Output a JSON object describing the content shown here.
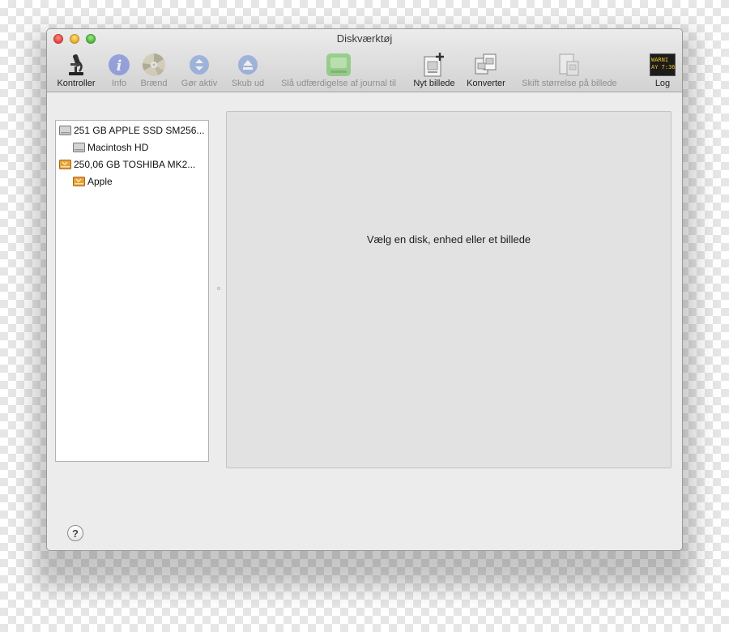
{
  "window": {
    "title": "Diskværktøj"
  },
  "toolbar": [
    {
      "id": "kontroller",
      "label": "Kontroller",
      "icon": "microscope-icon",
      "enabled": true
    },
    {
      "id": "info",
      "label": "Info",
      "icon": "info-icon",
      "enabled": false
    },
    {
      "id": "braend",
      "label": "Brænd",
      "icon": "burn-disc-icon",
      "enabled": false
    },
    {
      "id": "gor-aktiv",
      "label": "Gør aktiv",
      "icon": "mount-icon",
      "enabled": false
    },
    {
      "id": "skub-ud",
      "label": "Skub ud",
      "icon": "eject-icon",
      "enabled": false
    },
    {
      "id": "journal",
      "label": "Slå udfærdigelse af journal til",
      "icon": "journal-icon",
      "enabled": false
    },
    {
      "id": "nyt-billede",
      "label": "Nyt billede",
      "icon": "new-image-icon",
      "enabled": true
    },
    {
      "id": "konverter",
      "label": "Konverter",
      "icon": "convert-icon",
      "enabled": true
    },
    {
      "id": "skift",
      "label": "Skift størrelse på billede",
      "icon": "resize-image-icon",
      "enabled": false
    },
    {
      "id": "log",
      "label": "Log",
      "icon": "log-console-icon",
      "enabled": true,
      "console_text": [
        "WARNI",
        "AY 7:36"
      ]
    }
  ],
  "sidebar": {
    "items": [
      {
        "label": "251 GB APPLE SSD SM256...",
        "type": "disk",
        "level": 0
      },
      {
        "label": "Macintosh HD",
        "type": "volume",
        "level": 1
      },
      {
        "label": "250,06 GB TOSHIBA MK2...",
        "type": "external-disk",
        "level": 0
      },
      {
        "label": "Apple",
        "type": "external-volume",
        "level": 1
      }
    ]
  },
  "detail": {
    "placeholder": "Vælg en disk, enhed eller et billede"
  },
  "help": {
    "label": "?"
  },
  "colors": {
    "disabled_text": "#8f8f8f",
    "window_bg": "#ececec",
    "detail_bg": "#e2e2e2",
    "external_disk": "#e8a23a"
  }
}
